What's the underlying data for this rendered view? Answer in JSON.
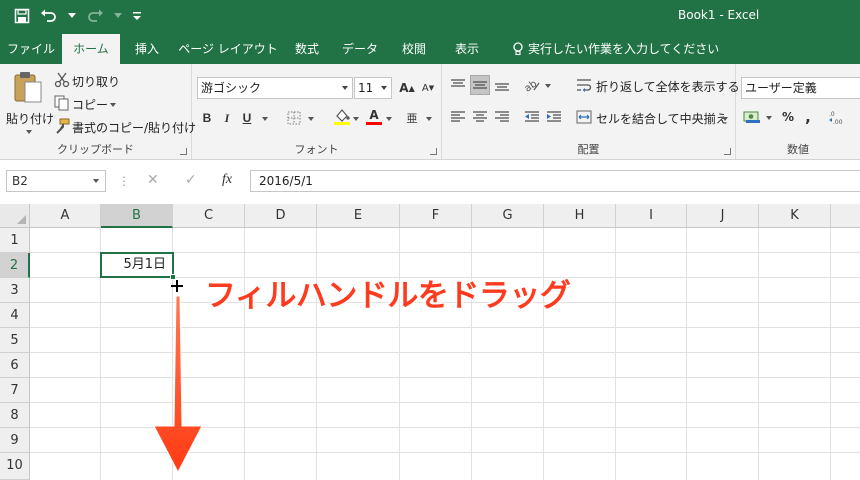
{
  "window": {
    "title": "Book1 - Excel"
  },
  "qat": {
    "save_icon": "save-icon",
    "undo_icon": "undo-icon",
    "redo_icon": "redo-icon",
    "customize_icon": "chevron-down-icon"
  },
  "tabs": [
    {
      "label": "ファイル"
    },
    {
      "label": "ホーム"
    },
    {
      "label": "挿入"
    },
    {
      "label": "ページ レイアウト"
    },
    {
      "label": "数式"
    },
    {
      "label": "データ"
    },
    {
      "label": "校閲"
    },
    {
      "label": "表示"
    }
  ],
  "tell_me": "実行したい作業を入力してください",
  "ribbon": {
    "clipboard": {
      "label": "クリップボード",
      "paste": "貼り付け",
      "cut": "切り取り",
      "copy": "コピー",
      "format_painter": "書式のコピー/貼り付け"
    },
    "font": {
      "label": "フォント",
      "font_name": "游ゴシック",
      "font_size": "11",
      "bold": "B",
      "italic": "I",
      "underline": "U",
      "grow": "A",
      "shrink": "A",
      "font_color_glyph": "A",
      "phonetic_glyph": "亜"
    },
    "alignment": {
      "label": "配置",
      "wrap_text": "折り返して全体を表示する",
      "merge_center": "セルを結合して中央揃え"
    },
    "number": {
      "label": "数値",
      "format": "ユーザー定義",
      "percent": "%",
      "comma": ","
    }
  },
  "formula_bar": {
    "name_box": "B2",
    "fx": "fx",
    "value": "2016/5/1"
  },
  "sheet": {
    "columns": [
      "A",
      "B",
      "C",
      "D",
      "E",
      "F",
      "G",
      "H",
      "I",
      "J",
      "K"
    ],
    "rows": [
      "1",
      "2",
      "3",
      "4",
      "5",
      "6",
      "7",
      "8",
      "9",
      "10"
    ],
    "active_cell": {
      "ref": "B2",
      "display": "5月1日"
    }
  },
  "annotation": {
    "text": "フィルハンドルをドラッグ"
  },
  "colors": {
    "excel_green": "#217346",
    "annotation_red": "#ff3b1f"
  }
}
